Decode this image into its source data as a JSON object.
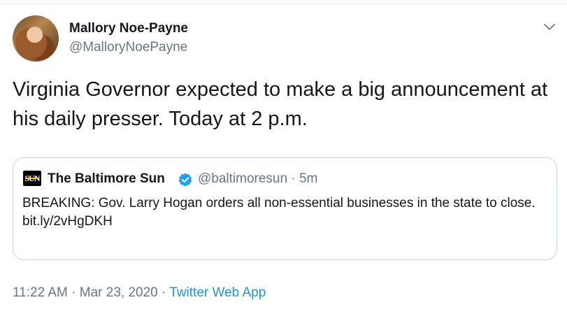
{
  "author": {
    "name": "Mallory Noe-Payne",
    "handle": "@MalloryNoePayne"
  },
  "tweet": {
    "text": "Virginia Governor expected to make a big announcement at his daily presser. Today at 2 p.m."
  },
  "quoted_tweet": {
    "logo_text": "SUN",
    "name": "The Baltimore Sun",
    "verified": true,
    "handle": "@baltimoresun",
    "separator": "·",
    "time": "5m",
    "text": "BREAKING: Gov. Larry Hogan orders all non-essential businesses in the state to close.",
    "link": "bit.ly/2vHgDKH"
  },
  "footer": {
    "time": "11:22 AM",
    "separator1": "·",
    "date": "Mar 23, 2020",
    "separator2": "·",
    "app": "Twitter Web App"
  },
  "colors": {
    "primary_text": "#14171a",
    "secondary_text": "#657786",
    "link": "#1b95e0",
    "verified_badge": "#1da1f2",
    "border": "#ccd6dd"
  },
  "icons": {
    "more_menu": "chevron-down-icon",
    "verified": "verified-badge-icon"
  }
}
